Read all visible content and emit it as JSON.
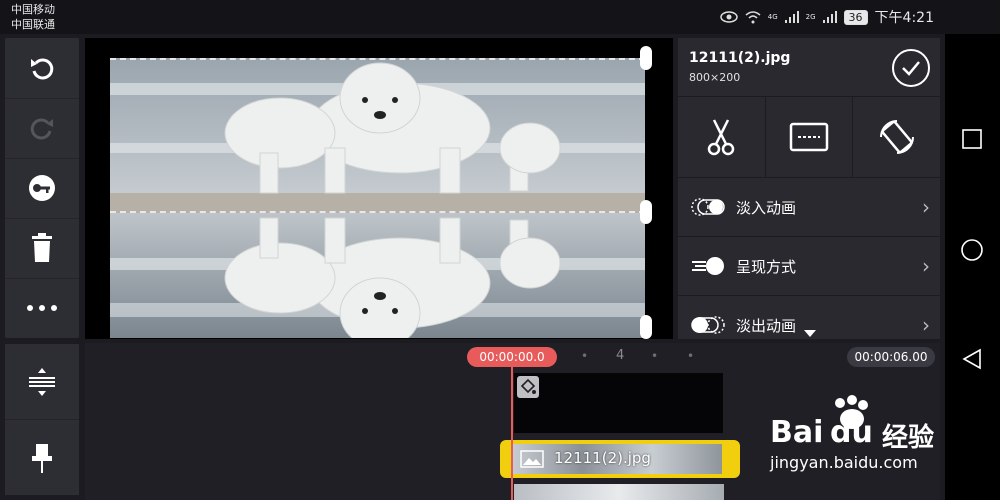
{
  "status_bar": {
    "carrier_1": "中国移动",
    "carrier_2": "中国联通",
    "network_1": "4G",
    "network_2": "2G",
    "battery": "36",
    "time": "下午4:21"
  },
  "left_tools": {
    "items": [
      "undo-icon",
      "redo-icon",
      "keyframe-icon",
      "delete-icon",
      "more-icon"
    ]
  },
  "left_bottom_tools": {
    "items": [
      "split-tracks-icon",
      "pin-icon"
    ]
  },
  "clip_info": {
    "title": "12111(2).jpg",
    "dimensions": "800×200"
  },
  "edit_icons": [
    "scissors-icon",
    "crop-icon",
    "rotate-icon"
  ],
  "animation_rows": [
    {
      "label": "淡入动画",
      "icon": "fade-in-icon"
    },
    {
      "label": "呈现方式",
      "icon": "present-icon"
    },
    {
      "label": "淡出动画",
      "icon": "fade-out-icon"
    }
  ],
  "timeline": {
    "current_time": "00:00:00.0",
    "marker": "4",
    "end_time": "00:00:06.00",
    "clip_label": "12111(2).jpg"
  },
  "watermark": {
    "brand": "Bai",
    "brand_suffix": "经验",
    "url": "jingyan.baidu.com"
  },
  "colors": {
    "playhead": "#e85b5b",
    "clip_border": "#f2cf0e",
    "panel": "#29292f"
  }
}
